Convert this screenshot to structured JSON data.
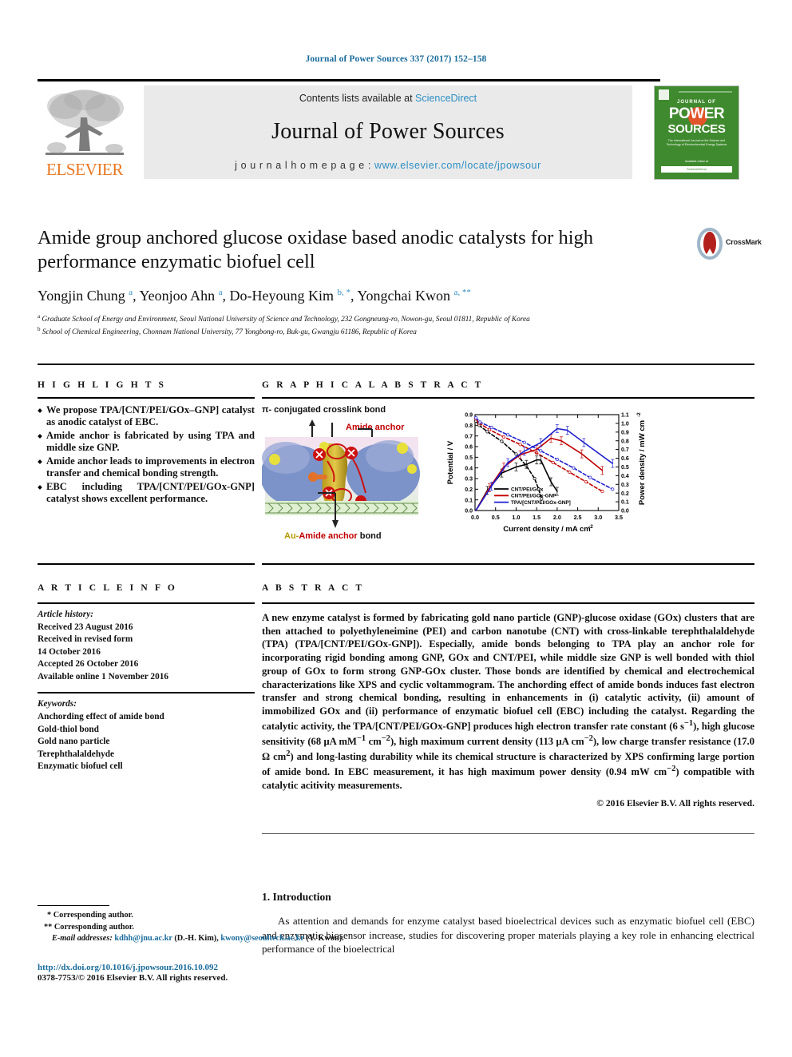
{
  "running_head": "Journal of Power Sources 337 (2017) 152–158",
  "masthead": {
    "contents_prefix": "Contents lists available at ",
    "sciencedirect": "ScienceDirect",
    "journal_title": "Journal of Power Sources",
    "homepage_label": "j o u r n a l   h o m e p a g e :   ",
    "homepage_url": "www.elsevier.com/locate/jpowsour",
    "publisher": "ELSEVIER",
    "cover": {
      "journal_word": "JOURNAL OF",
      "power": "POWER",
      "sources": "SOURCES",
      "subtitle": "The International Journal on the Science and Technology of Electrochemical Energy Systems",
      "footer": "Available online at",
      "footer2": "ScienceDirect"
    }
  },
  "article": {
    "title": "Amide group anchored glucose oxidase based anodic catalysts for high performance enzymatic biofuel cell",
    "authors_html": "Yongjin Chung <sup>a</sup>, Yeonjoo Ahn <sup>a</sup>, Do-Heyoung Kim <sup>b, *</sup>, Yongchai Kwon <sup>a, **</sup>",
    "affiliation_a": "Graduate School of Energy and Environment, Seoul National University of Science and Technology, 232 Gongneung-ro, Nowon-gu, Seoul 01811, Republic of Korea",
    "affiliation_b": "School of Chemical Engineering, Chonnam National University, 77 Yongbong-ro, Buk-gu, Gwangju 61186, Republic of Korea",
    "crossmark_label": "CrossMark"
  },
  "highlights": {
    "heading": "H I G H L I G H T S",
    "items": [
      "We propose TPA/[CNT/PEI/GOx–GNP] catalyst as anodic catalyst of EBC.",
      "Amide anchor is fabricated by using TPA and middle size GNP.",
      "Amide anchor leads to improvements in electron transfer and chemical bonding strength.",
      "EBC including TPA/[CNT/PEI/GOx-GNP] catalyst shows excellent performance."
    ]
  },
  "graphical_abstract": {
    "heading": "G R A P H I C A L   A B S T R A C T",
    "caption_top": "π- conjugated crosslink bond",
    "caption_amide": "Amide anchor",
    "caption_bottom_au": "Au-",
    "caption_bottom_amide": "Amide anchor",
    "caption_bottom_bond": " bond"
  },
  "chart_data": {
    "type": "line",
    "title": "",
    "xlabel": "Current density / mA cm",
    "xlabel_sup": "-2",
    "ylabel": "Potential / V",
    "y2label": "Power density / mW cm",
    "y2label_sup": "-2",
    "xlim": [
      0.0,
      3.5
    ],
    "ylim": [
      0.0,
      0.9
    ],
    "y2lim": [
      0.0,
      1.1
    ],
    "xticks": [
      "0.0",
      "0.5",
      "1.0",
      "1.5",
      "2.0",
      "2.5",
      "3.0",
      "3.5"
    ],
    "yticks": [
      "0.0",
      "0.1",
      "0.2",
      "0.3",
      "0.4",
      "0.5",
      "0.6",
      "0.7",
      "0.8",
      "0.9"
    ],
    "y2ticks": [
      "0.0",
      "0.1",
      "0.2",
      "0.3",
      "0.4",
      "0.5",
      "0.6",
      "0.7",
      "0.8",
      "0.9",
      "1.0",
      "1.1"
    ],
    "grid": false,
    "legend_position": "bottom-left",
    "legend": [
      "CNT/PEI/GOx",
      "CNT/PEI/GOx-GNP",
      "TPA/[CNT/PEI/GOx-GNP]"
    ],
    "colors": {
      "series1": "#000000",
      "series2": "#c00000",
      "series3": "#1f1fd0"
    },
    "series": [
      {
        "name": "CNT/PEI/GOx",
        "style": "dashed",
        "axis": "left",
        "comment": "polarization curve (potential vs current density)",
        "x": [
          0.02,
          0.1,
          0.3,
          0.65,
          1.0,
          1.25,
          1.45,
          1.55,
          1.62
        ],
        "y": [
          0.84,
          0.8,
          0.74,
          0.65,
          0.53,
          0.42,
          0.3,
          0.2,
          0.11
        ]
      },
      {
        "name": "CNT/PEI/GOx-GNP",
        "style": "dashed",
        "axis": "left",
        "x": [
          0.02,
          0.1,
          0.35,
          0.7,
          1.1,
          1.5,
          1.9,
          2.3,
          2.7,
          3.1
        ],
        "y": [
          0.86,
          0.82,
          0.76,
          0.69,
          0.62,
          0.54,
          0.45,
          0.36,
          0.27,
          0.18
        ]
      },
      {
        "name": "TPA/[CNT/PEI/GOx-GNP]",
        "style": "dashed",
        "axis": "left",
        "x": [
          0.02,
          0.12,
          0.4,
          0.8,
          1.2,
          1.6,
          2.0,
          2.4,
          2.8,
          3.35
        ],
        "y": [
          0.87,
          0.83,
          0.78,
          0.71,
          0.64,
          0.56,
          0.48,
          0.4,
          0.31,
          0.2
        ]
      },
      {
        "name": "CNT/PEI/GOx power",
        "style": "solid",
        "axis": "right",
        "x": [
          0.02,
          0.3,
          0.65,
          1.0,
          1.25,
          1.5,
          1.6,
          1.85,
          2.0
        ],
        "y2": [
          0.0,
          0.23,
          0.43,
          0.5,
          0.53,
          0.58,
          0.58,
          0.33,
          0.22
        ]
      },
      {
        "name": "CNT/PEI/GOx-GNP power",
        "style": "solid",
        "axis": "right",
        "x": [
          0.02,
          0.35,
          0.7,
          1.1,
          1.5,
          1.85,
          2.1,
          2.6,
          3.1
        ],
        "y2": [
          0.0,
          0.26,
          0.5,
          0.64,
          0.7,
          0.83,
          0.8,
          0.65,
          0.46
        ]
      },
      {
        "name": "TPA/[CNT/PEI/GOx-GNP] power",
        "style": "solid",
        "axis": "right",
        "x": [
          0.02,
          0.4,
          0.8,
          1.2,
          1.6,
          2.0,
          2.25,
          2.65,
          3.35
        ],
        "y2": [
          0.0,
          0.28,
          0.55,
          0.68,
          0.78,
          0.94,
          0.92,
          0.78,
          0.54
        ]
      }
    ]
  },
  "article_info": {
    "heading": "A R T I C L E   I N F O",
    "history_label": "Article history:",
    "history": [
      "Received 23 August 2016",
      "Received in revised form",
      "14 October 2016",
      "Accepted 26 October 2016",
      "Available online 1 November 2016"
    ],
    "keywords_label": "Keywords:",
    "keywords": [
      "Anchording effect of amide bond",
      "Gold-thiol bond",
      "Gold nano particle",
      "Terephthalaldehyde",
      "Enzymatic biofuel cell"
    ]
  },
  "abstract": {
    "heading": "A B S T R A C T",
    "paragraph_1": "A new enzyme catalyst is formed by fabricating gold nano particle (GNP)-glucose oxidase (GOx) clusters that are then attached to polyethyleneimine (PEI) and carbon nanotube (CNT) with cross-linkable terephthalaldehyde (TPA) (TPA/[CNT/PEI/GOx-GNP]). Especially, amide bonds belonging to TPA play an anchor role for incorporating rigid bonding among GNP, GOx and CNT/PEI, while middle size GNP is well bonded with thiol group of GOx to form strong GNP-GOx cluster. Those bonds are identified by chemical and electrochemical characterizations like XPS and cyclic voltammogram. The anchording effect of amide bonds induces fast electron transfer and strong chemical bonding, resulting in enhancements in (i) catalytic activity, (ii) amount of immobilized GOx and (ii) performance of enzymatic biofuel cell (EBC) including the catalyst. Regarding the catalytic activity, the TPA/[CNT/PEI/GOx-GNP] produces high electron transfer rate constant (6 s",
    "sup_1": "−1",
    "paragraph_2": "), high glucose sensitivity (68 μA mM",
    "sup_2": "−1",
    "paragraph_3": " cm",
    "sup_3": "−2",
    "paragraph_4": "), high maximum current density (113 μA cm",
    "sup_4": "−2",
    "paragraph_5": "), low charge transfer resistance (17.0 Ω cm",
    "sup_5": "2",
    "paragraph_6": ") and long-lasting durability while its chemical structure is characterized by XPS confirming large portion of amide bond. In EBC measurement, it has high maximum power density (0.94 mW cm",
    "sup_6": "−2",
    "paragraph_7": ") compatible with catalytic acitivity measurements.",
    "copyright": "© 2016 Elsevier B.V. All rights reserved."
  },
  "introduction": {
    "heading": "1.  Introduction",
    "paragraph": "As attention and demands for enzyme catalyst based bioelectrical devices such as enzymatic biofuel cell (EBC) and enzymatic biosensor increase, studies for discovering proper materials playing a key role in enhancing electrical performance of the bioelectrical"
  },
  "footnotes": {
    "corr1_marker": "*",
    "corr1": "Corresponding author.",
    "corr2_marker": "**",
    "corr2": "Corresponding author.",
    "email_label": "E-mail addresses:",
    "email1": "kdhh@jnu.ac.kr",
    "email1_who": "(D.-H.  Kim),",
    "email2": "kwony@seoultech.ac.kr",
    "email2_who": "(Y. Kwon).",
    "doi": "http://dx.doi.org/10.1016/j.jpowsour.2016.10.092",
    "issn": "0378-7753/© 2016 Elsevier B.V. All rights reserved."
  }
}
